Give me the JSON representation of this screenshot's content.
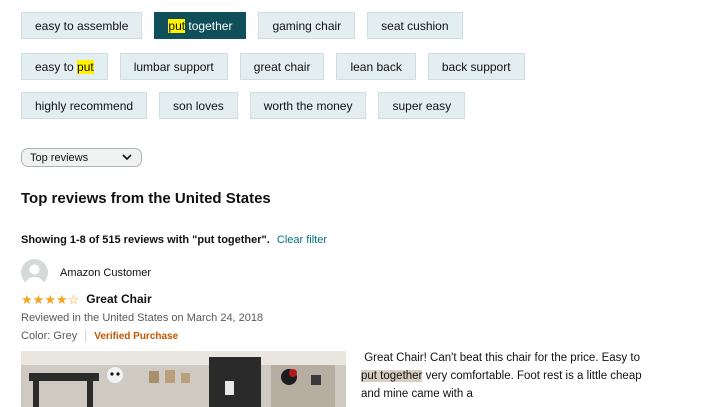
{
  "filter_chips": {
    "row1": [
      {
        "pre": "easy to assemble",
        "hl": "",
        "post": ""
      },
      {
        "pre": "",
        "hl": "put",
        "post": " together",
        "active": true
      },
      {
        "pre": "gaming chair",
        "hl": "",
        "post": ""
      },
      {
        "pre": "seat cushion",
        "hl": "",
        "post": ""
      }
    ],
    "row2": [
      {
        "pre": "easy to ",
        "hl": "put",
        "post": ""
      },
      {
        "pre": "lumbar support",
        "hl": "",
        "post": ""
      },
      {
        "pre": "great chair",
        "hl": "",
        "post": ""
      },
      {
        "pre": "lean back",
        "hl": "",
        "post": ""
      },
      {
        "pre": "back support",
        "hl": "",
        "post": ""
      }
    ],
    "row3": [
      {
        "pre": "highly recommend",
        "hl": "",
        "post": ""
      },
      {
        "pre": "son loves",
        "hl": "",
        "post": ""
      },
      {
        "pre": "worth the money",
        "hl": "",
        "post": ""
      },
      {
        "pre": "super easy",
        "hl": "",
        "post": ""
      }
    ]
  },
  "sort": {
    "selected": "Top reviews"
  },
  "section_title": "Top reviews from the United States",
  "showing": {
    "text": "Showing 1-8 of 515 reviews with \"put together\".",
    "clear_filter": "Clear filter"
  },
  "review": {
    "reviewer": "Amazon Customer",
    "rating": 4,
    "max_rating": 5,
    "title": "Great Chair",
    "meta": "Reviewed in the United States on March 24, 2018",
    "variant": "Color: Grey",
    "verified": "Verified Purchase",
    "text_pre": " Great Chair! Can't beat this chair for the price. Easy to ",
    "text_hl": "put together",
    "text_post": " very comfortable. Foot rest is a little cheap and mine came with a"
  },
  "colors": {
    "accent": "#007185",
    "star": "#f4a41d",
    "active_chip": "#0f4f5a",
    "verified": "#c45500"
  }
}
